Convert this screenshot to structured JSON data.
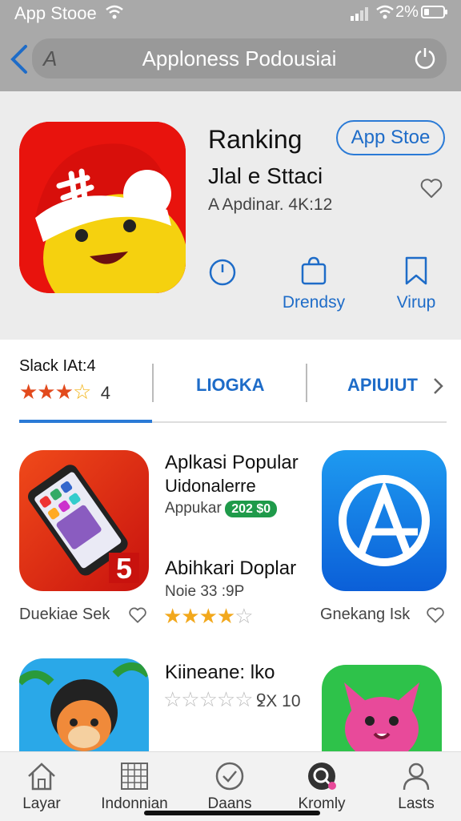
{
  "status_bar": {
    "carrier": "App Stooe",
    "battery_pct": "2%"
  },
  "nav": {
    "url_prefix": "A",
    "title": "Apploness Podousiai"
  },
  "hero": {
    "title": "Ranking",
    "store_button": "App Stoe",
    "subtitle": "Jlal e Sttaci",
    "meta": "A Apdinar. 4K:12",
    "actions": [
      {
        "label": "",
        "icon": "clock-icon"
      },
      {
        "label": "Drendsy",
        "icon": "shopping-bag-icon"
      },
      {
        "label": "Virup",
        "icon": "bookmark-icon"
      }
    ]
  },
  "tabs": {
    "slack_label": "Slack IAt:4",
    "rating_stars": 3.5,
    "rating_value": "4",
    "tab1": "LIOGKA",
    "tab2": "APIUIUT"
  },
  "apps": {
    "row1": {
      "left_caption": "Duekiae Sek",
      "left_badge_number": "5",
      "title": "Aplkasi Popular",
      "subtitle": "Uidonalerre",
      "meta": "Appukar",
      "badge": "202 $0",
      "title2": "Abihkari Doplar",
      "meta2": "Noie 33 :9P",
      "stars": 4,
      "right_caption": "Gnekang Isk"
    },
    "row2": {
      "title": "Kiineane: lko",
      "rating_text": "ꝿX 10"
    }
  },
  "tabbar": [
    {
      "label": "Layar",
      "icon": "home-icon"
    },
    {
      "label": "Indonnian",
      "icon": "grid-icon"
    },
    {
      "label": "Daans",
      "icon": "check-circle-icon"
    },
    {
      "label": "Kromly",
      "icon": "search-icon"
    },
    {
      "label": "Lasts",
      "icon": "person-icon"
    }
  ],
  "colors": {
    "accent": "#1e6cc8",
    "badge": "#1f9a4a",
    "star": "#f2a81c"
  }
}
